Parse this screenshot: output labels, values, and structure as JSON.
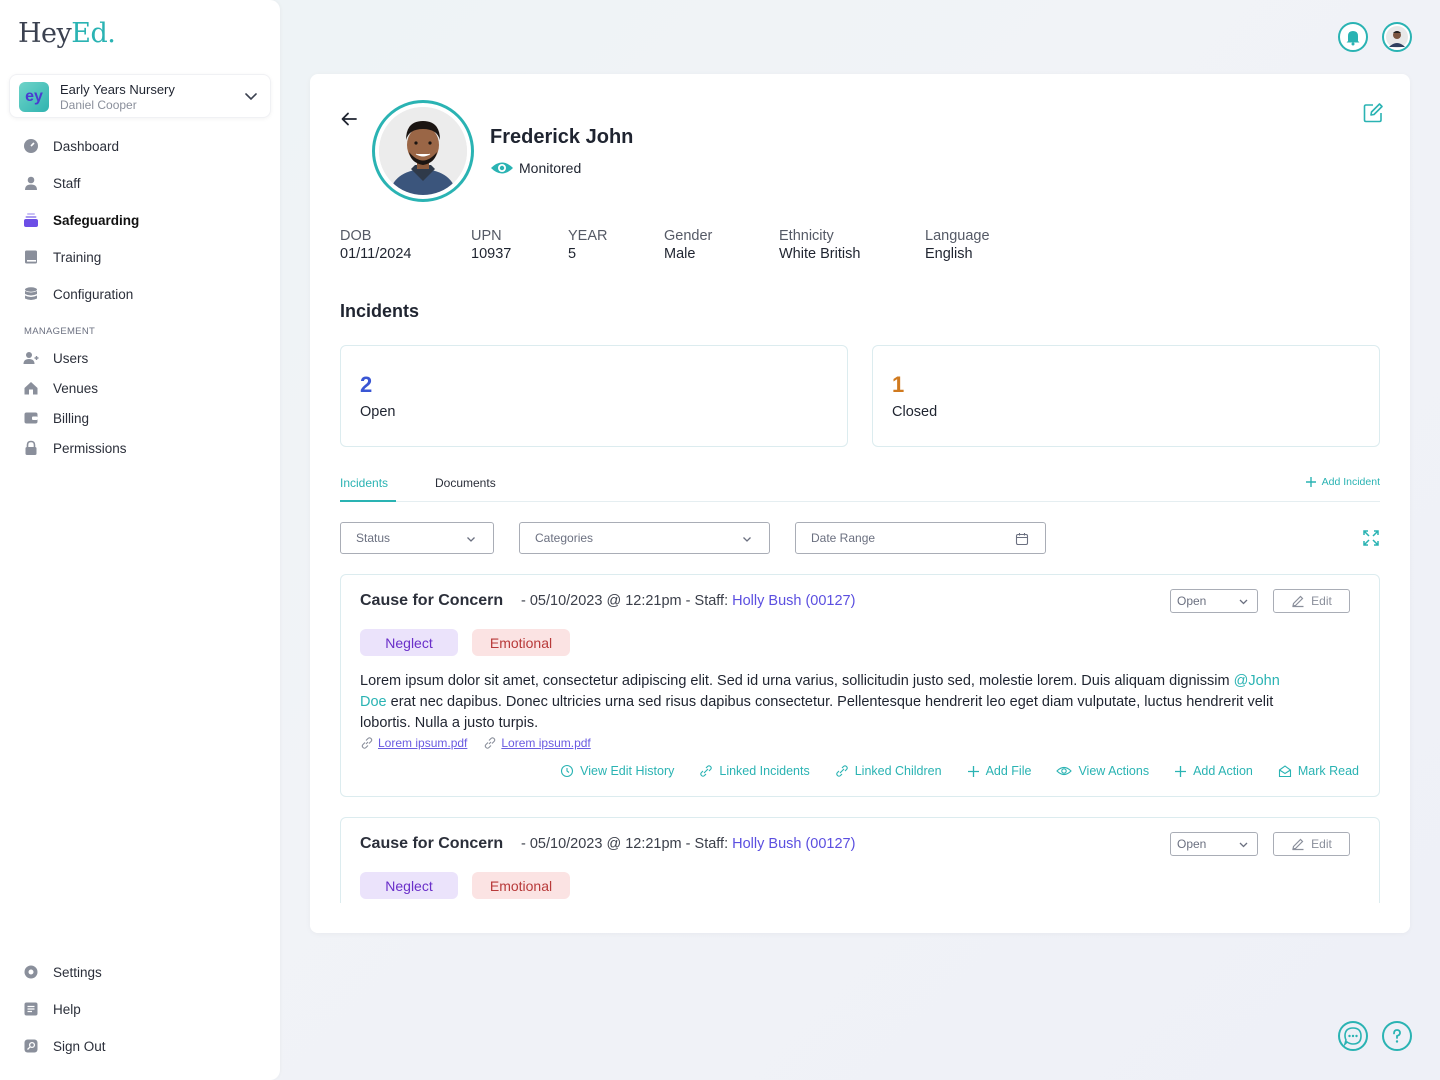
{
  "brand": {
    "logo_main": "Hey",
    "logo_accent": "Ed."
  },
  "org": {
    "badge": "ey",
    "name": "Early Years Nursery",
    "user": "Daniel Cooper"
  },
  "sidebar": {
    "items": [
      {
        "label": "Dashboard",
        "icon": "dashboard-icon"
      },
      {
        "label": "Staff",
        "icon": "person-icon"
      },
      {
        "label": "Safeguarding",
        "icon": "safeguarding-icon",
        "active": true
      },
      {
        "label": "Training",
        "icon": "book-icon"
      },
      {
        "label": "Configuration",
        "icon": "database-icon"
      }
    ],
    "management_label": "MANAGEMENT",
    "management_items": [
      {
        "label": "Users",
        "icon": "users-icon"
      },
      {
        "label": "Venues",
        "icon": "home-icon"
      },
      {
        "label": "Billing",
        "icon": "wallet-icon"
      },
      {
        "label": "Permissions",
        "icon": "lock-icon"
      }
    ],
    "footer_items": [
      {
        "label": "Settings",
        "icon": "gear-icon"
      },
      {
        "label": "Help",
        "icon": "help-doc-icon"
      },
      {
        "label": "Sign Out",
        "icon": "sign-out-icon"
      }
    ]
  },
  "profile": {
    "name": "Frederick John",
    "status": "Monitored",
    "fields": [
      {
        "label": "DOB",
        "value": "01/11/2024"
      },
      {
        "label": "UPN",
        "value": "10937"
      },
      {
        "label": "YEAR",
        "value": "5"
      },
      {
        "label": "Gender",
        "value": "Male"
      },
      {
        "label": "Ethnicity",
        "value": "White British"
      },
      {
        "label": "Language",
        "value": "English"
      }
    ]
  },
  "incidents_section": {
    "title": "Incidents",
    "open": {
      "count": "2",
      "label": "Open"
    },
    "closed": {
      "count": "1",
      "label": "Closed"
    }
  },
  "tabs": [
    {
      "label": "Incidents",
      "active": true
    },
    {
      "label": "Documents"
    }
  ],
  "add_incident_label": "Add Incident",
  "filters": {
    "status": "Status",
    "categories": "Categories",
    "date_range": "Date Range"
  },
  "incidents": [
    {
      "title": "Cause for Concern",
      "meta_prefix": "- 05/10/2023 @ 12:21pm - Staff: ",
      "staff": "Holly Bush (00127)",
      "status": "Open",
      "edit_label": "Edit",
      "tags": [
        "Neglect",
        "Emotional"
      ],
      "body_part1": "Lorem ipsum dolor sit amet, consectetur adipiscing elit. Sed id urna varius, sollicitudin justo sed, molestie lorem. Duis aliquam dignissim ",
      "mention": "@John Doe",
      "body_part2": " erat nec dapibus. Donec ultricies urna sed risus dapibus consectetur. Pellentesque hendrerit leo eget diam vulputate, luctus hendrerit velit lobortis. Nulla a justo turpis.",
      "attachments": [
        "Lorem ipsum.pdf",
        "Lorem ipsum.pdf"
      ],
      "actions": [
        "View Edit History",
        "Linked Incidents",
        "Linked Children",
        "Add File",
        "View Actions",
        "Add Action",
        "Mark Read"
      ]
    },
    {
      "title": "Cause for Concern",
      "meta_prefix": "- 05/10/2023 @ 12:21pm - Staff: ",
      "staff": "Holly Bush (00127)",
      "status": "Open",
      "edit_label": "Edit",
      "tags": [
        "Neglect",
        "Emotional"
      ]
    }
  ],
  "colors": {
    "accent": "#2ab3b3",
    "open": "#3a56d4",
    "closed": "#d07a1f",
    "staff_link": "#5b4fe0"
  }
}
